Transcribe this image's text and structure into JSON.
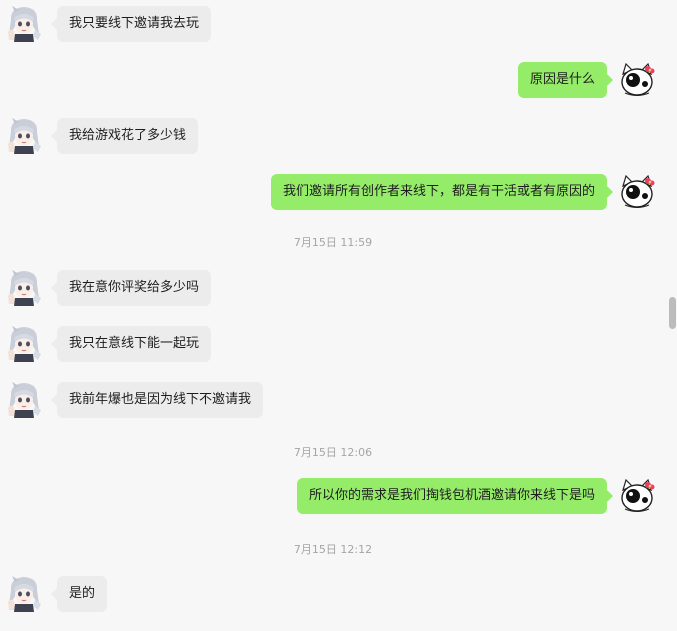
{
  "messages": [
    {
      "side": "left",
      "text": "我只要线下邀请我去玩"
    },
    {
      "side": "right",
      "text": "原因是什么"
    },
    {
      "side": "left",
      "text": "我给游戏花了多少钱"
    },
    {
      "side": "right",
      "text": "我们邀请所有创作者来线下，都是有干活或者有原因的"
    },
    {
      "timestamp": "7月15日 11:59"
    },
    {
      "side": "left",
      "text": "我在意你评奖给多少吗"
    },
    {
      "side": "left",
      "text": "我只在意线下能一起玩"
    },
    {
      "side": "left",
      "text": "我前年爆也是因为线下不邀请我"
    },
    {
      "timestamp": "7月15日 12:06"
    },
    {
      "side": "right",
      "text": "所以你的需求是我们掏钱包机酒邀请你来线下是吗"
    },
    {
      "timestamp": "7月15日 12:12"
    },
    {
      "side": "left",
      "text": "是的"
    }
  ],
  "colors": {
    "background": "#f7f7f7",
    "bubble_left": "#ececec",
    "bubble_right": "#95ec69",
    "timestamp": "#a5a5a5"
  },
  "icons": {
    "left_avatar": "anime-girl-avatar",
    "right_avatar": "white-cat-avatar"
  }
}
